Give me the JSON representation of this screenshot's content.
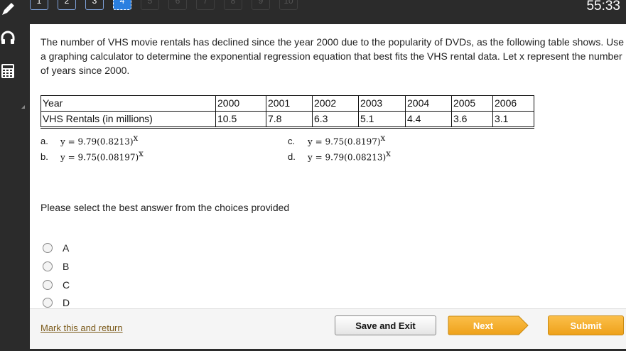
{
  "nav": {
    "questions": [
      "1",
      "2",
      "3",
      "4",
      "5",
      "6",
      "7",
      "8",
      "9",
      "10"
    ],
    "active_index": 3,
    "timer": "55:33"
  },
  "sidebar": {
    "tools": [
      "pencil-icon",
      "headphones-icon",
      "calculator-icon"
    ]
  },
  "question": {
    "text": "The number of VHS movie rentals has declined since the year 2000 due to the popularity of DVDs, as the following table shows.  Use a graphing calculator to determine the exponential regression equation that best fits the VHS rental data.  Let x represent the number of years since 2000.",
    "table": {
      "row1_label": "Year",
      "row2_label": "VHS Rentals (in millions)",
      "years": [
        "2000",
        "2001",
        "2002",
        "2003",
        "2004",
        "2005",
        "2006"
      ],
      "rentals": [
        "10.5",
        "7.8",
        "6.3",
        "5.1",
        "4.4",
        "3.6",
        "3.1"
      ]
    },
    "choices": {
      "a_label": "a.",
      "a_eq": "y = 9.79(0.8213)",
      "b_label": "b.",
      "b_eq": "y = 9.75(0.08197)",
      "c_label": "c.",
      "c_eq": "y = 9.75(0.8197)",
      "d_label": "d.",
      "d_eq": "y = 9.79(0.08213)",
      "exponent": "x"
    }
  },
  "answer": {
    "prompt": "Please select the best answer from the choices provided",
    "options": [
      "A",
      "B",
      "C",
      "D"
    ]
  },
  "footer": {
    "mark_link": "Mark this and return",
    "save_label": "Save and Exit",
    "next_label": "Next",
    "submit_label": "Submit"
  },
  "colors": {
    "accent_blue": "#2a7fe0",
    "button_orange": "#f0a62a",
    "dark_bg": "#2b2b2b"
  }
}
